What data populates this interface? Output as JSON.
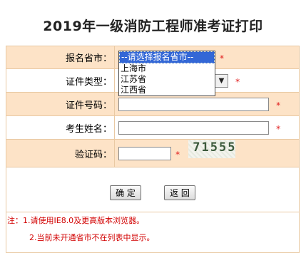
{
  "page": {
    "title": "2019年一级消防工程师准考证打印"
  },
  "form": {
    "province": {
      "label": "报名省市：",
      "selected": "--请选择报名省市--",
      "options": [
        "--请选择报名省市--",
        "上海市",
        "江苏省",
        "江西省"
      ]
    },
    "id_type": {
      "label": "证件类型："
    },
    "id_number": {
      "label": "证件号码：",
      "value": ""
    },
    "name": {
      "label": "考生姓名：",
      "value": ""
    },
    "captcha": {
      "label": "验证码：",
      "value": "",
      "image_text": "71555"
    },
    "required_mark": "*"
  },
  "buttons": {
    "confirm": "确 定",
    "back": "返 回"
  },
  "notes": {
    "prefix": "注：",
    "line1": "1.请使用IE8.0及更高版本浏览器。",
    "line2": "2.当前未开通省市不在列表中显示。"
  },
  "colors": {
    "row_alt": "#fde3c7",
    "border": "#e9c9a3",
    "required": "#e01b1b"
  }
}
